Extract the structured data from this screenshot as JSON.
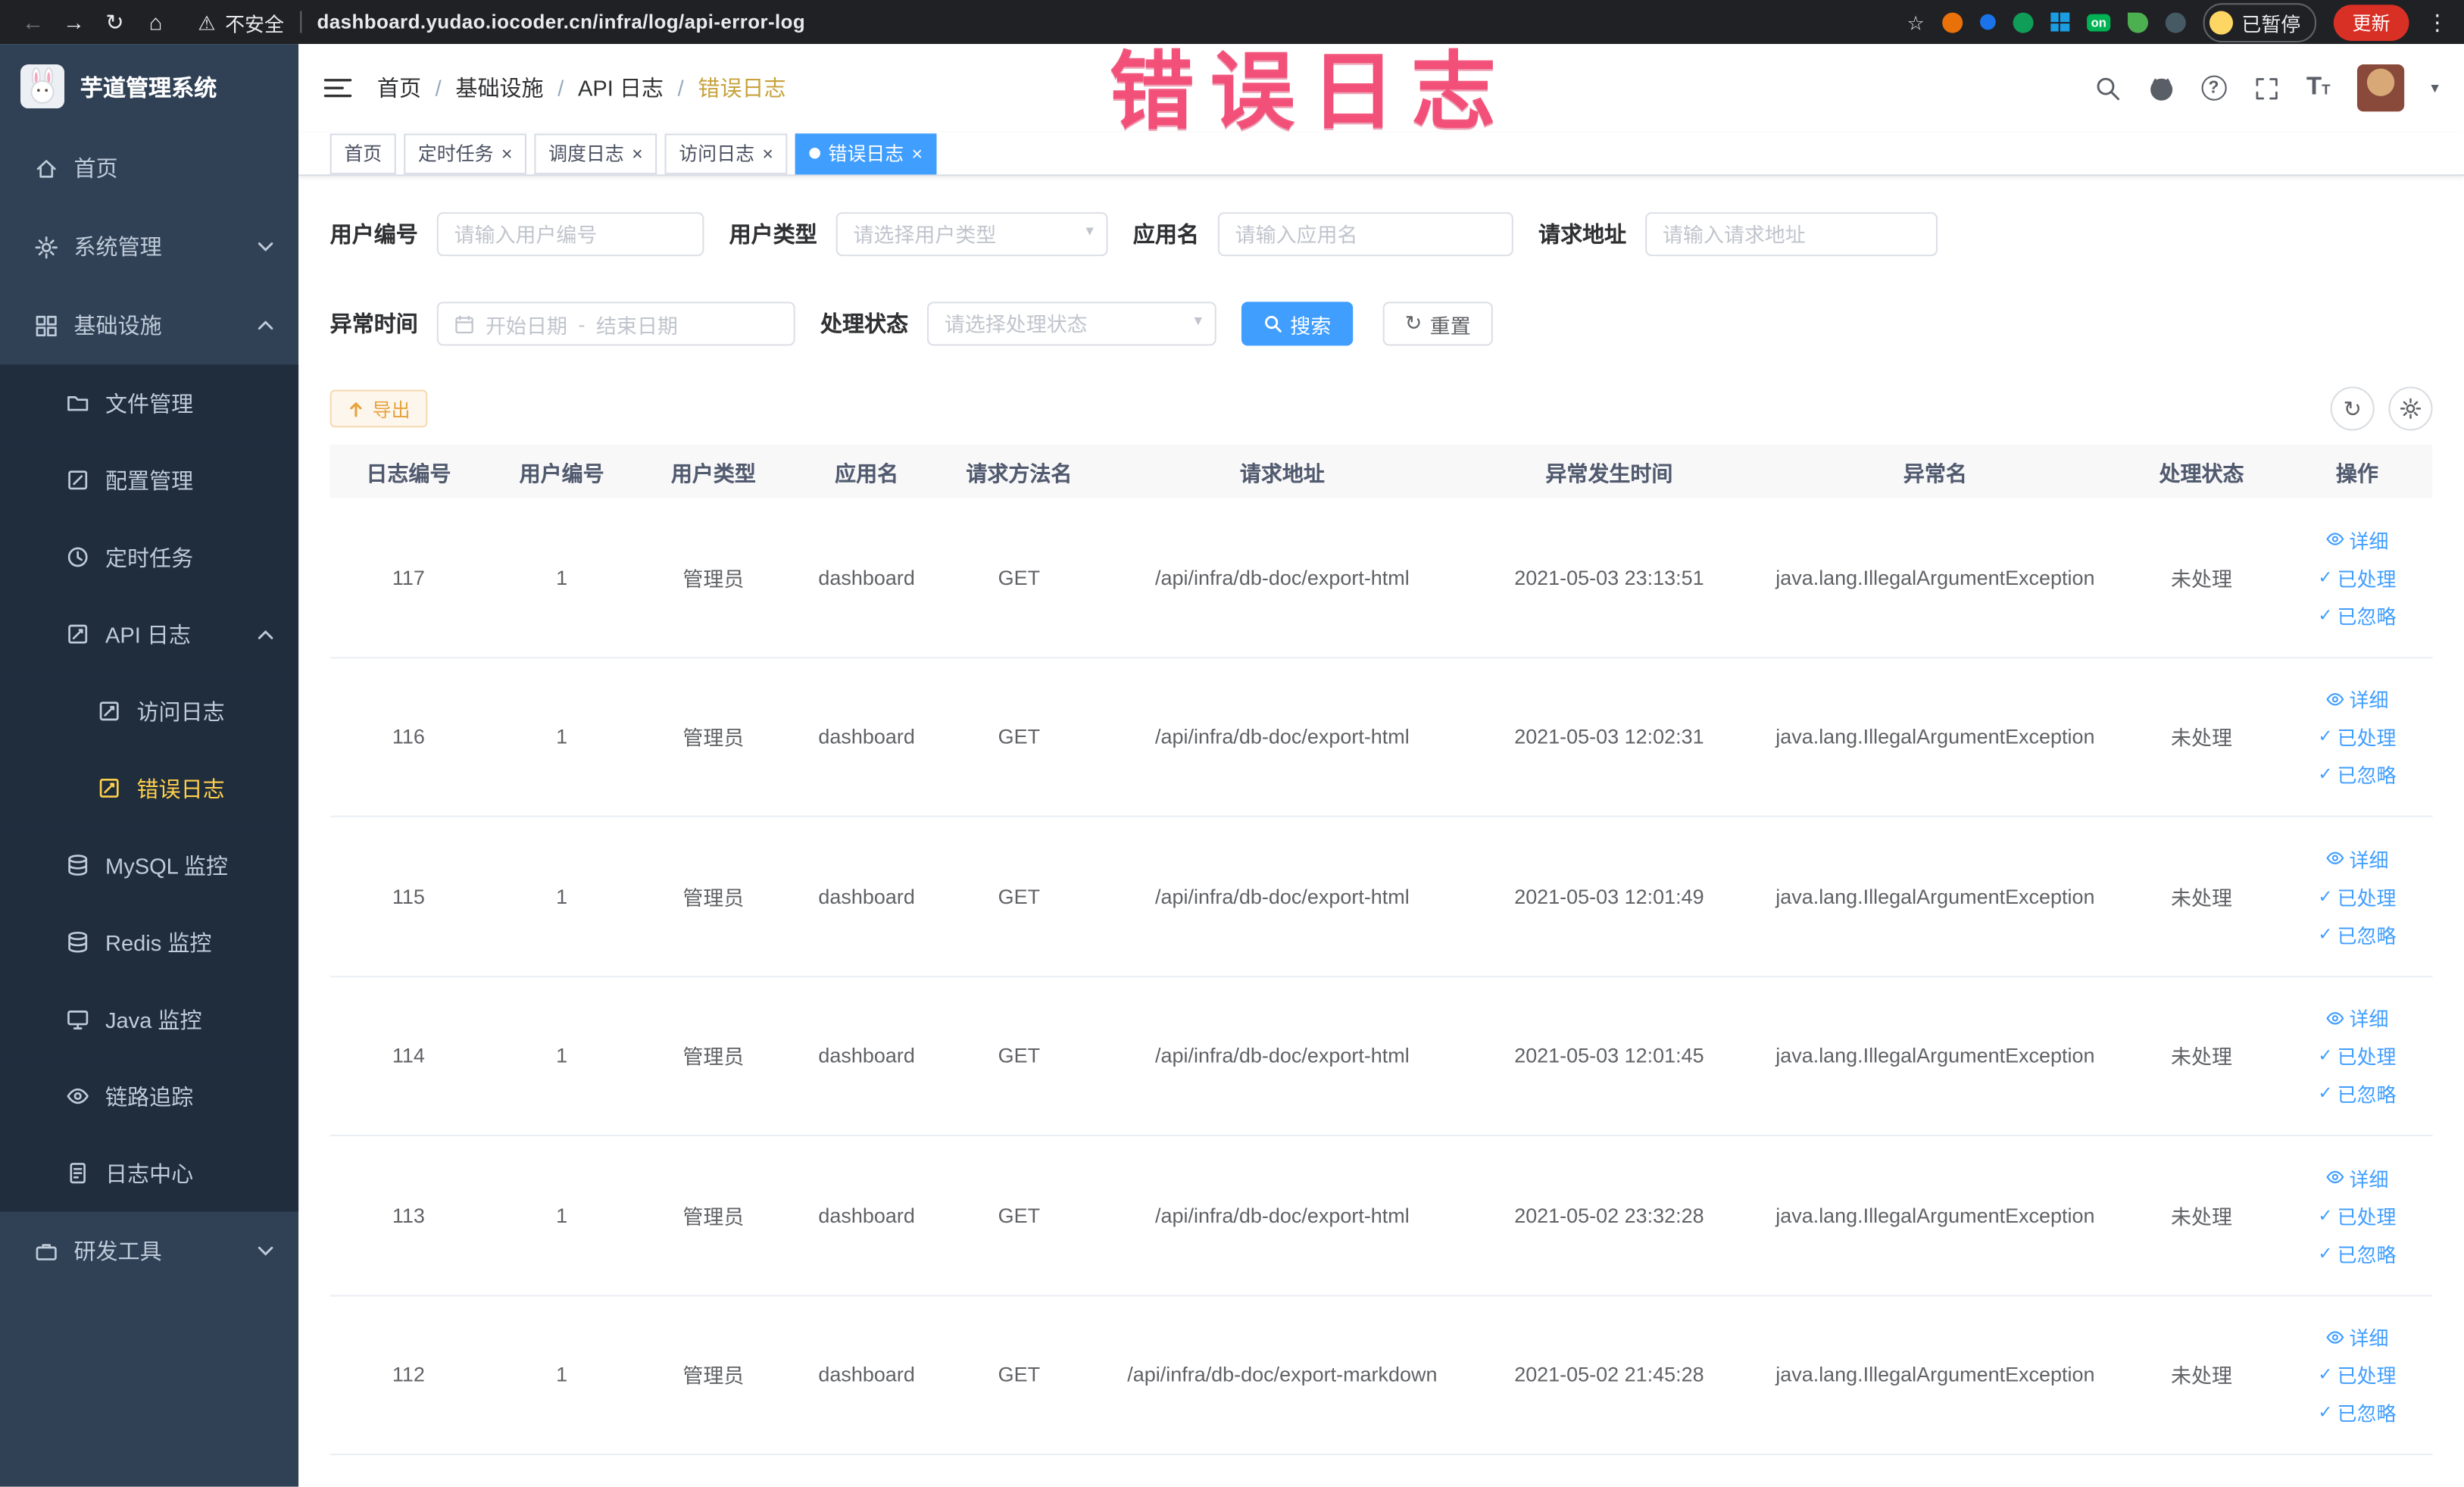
{
  "browser": {
    "security_label": "不安全",
    "url": "dashboard.yudao.iocoder.cn/infra/log/api-error-log",
    "paused_label": "已暂停",
    "update_label": "更新",
    "extension_badge_on": "on"
  },
  "icons": {
    "back": "←",
    "forward": "→",
    "reload": "↻",
    "home": "⌂",
    "warning": "⚠",
    "star": "☆",
    "more": "⋮",
    "close": "×",
    "check": "✓",
    "question": "?",
    "caret_down": "▾",
    "separator": "/",
    "refresh": "↻",
    "font_large": "T",
    "font_small": "T"
  },
  "annotation": {
    "text": "错误日志",
    "color": "#f24972"
  },
  "sidebar": {
    "title": "芋道管理系统",
    "items": [
      {
        "label": "首页",
        "level": 1,
        "icon": "home-icon"
      },
      {
        "label": "系统管理",
        "level": 1,
        "icon": "gear-icon",
        "expandable": true,
        "expanded": false
      },
      {
        "label": "基础设施",
        "level": 1,
        "icon": "infra-icon",
        "expandable": true,
        "expanded": true
      },
      {
        "label": "文件管理",
        "level": 2,
        "icon": "folder-icon"
      },
      {
        "label": "配置管理",
        "level": 2,
        "icon": "config-icon"
      },
      {
        "label": "定时任务",
        "level": 2,
        "icon": "clock-icon"
      },
      {
        "label": "API 日志",
        "level": 2,
        "icon": "api-log-icon",
        "expandable": true,
        "expanded": true
      },
      {
        "label": "访问日志",
        "level": 3,
        "icon": "access-log-icon"
      },
      {
        "label": "错误日志",
        "level": 3,
        "icon": "error-log-icon",
        "active": true
      },
      {
        "label": "MySQL 监控",
        "level": 2,
        "icon": "mysql-icon"
      },
      {
        "label": "Redis 监控",
        "level": 2,
        "icon": "redis-icon"
      },
      {
        "label": "Java 监控",
        "level": 2,
        "icon": "java-icon"
      },
      {
        "label": "链路追踪",
        "level": 2,
        "icon": "trace-icon"
      },
      {
        "label": "日志中心",
        "level": 2,
        "icon": "log-center-icon"
      },
      {
        "label": "研发工具",
        "level": 1,
        "icon": "devtools-icon",
        "expandable": true,
        "expanded": false
      }
    ]
  },
  "header": {
    "breadcrumb": [
      "首页",
      "基础设施",
      "API 日志",
      "错误日志"
    ]
  },
  "tabs": [
    {
      "label": "首页",
      "closable": false,
      "active": false
    },
    {
      "label": "定时任务",
      "closable": true,
      "active": false
    },
    {
      "label": "调度日志",
      "closable": true,
      "active": false
    },
    {
      "label": "访问日志",
      "closable": true,
      "active": false
    },
    {
      "label": "错误日志",
      "closable": true,
      "active": true
    }
  ],
  "filters": {
    "user_id": {
      "label": "用户编号",
      "placeholder": "请输入用户编号"
    },
    "user_type": {
      "label": "用户类型",
      "placeholder": "请选择用户类型"
    },
    "app_name": {
      "label": "应用名",
      "placeholder": "请输入应用名"
    },
    "request_url": {
      "label": "请求地址",
      "placeholder": "请输入请求地址"
    },
    "exception_time": {
      "label": "异常时间",
      "start_placeholder": "开始日期",
      "separator": "-",
      "end_placeholder": "结束日期"
    },
    "process_status": {
      "label": "处理状态",
      "placeholder": "请选择处理状态"
    },
    "search_label": "搜索",
    "reset_label": "重置"
  },
  "toolbar": {
    "export_label": "导出"
  },
  "table": {
    "columns": [
      "日志编号",
      "用户编号",
      "用户类型",
      "应用名",
      "请求方法名",
      "请求地址",
      "异常发生时间",
      "异常名",
      "处理状态",
      "操作"
    ],
    "action_labels": {
      "detail": "详细",
      "processed": "已处理",
      "ignored": "已忽略"
    },
    "rows": [
      {
        "id": "117",
        "user_id": "1",
        "user_type": "管理员",
        "app": "dashboard",
        "method": "GET",
        "url": "/api/infra/db-doc/export-html",
        "time": "2021-05-03 23:13:51",
        "exception": "java.lang.IllegalArgumentException",
        "status": "未处理"
      },
      {
        "id": "116",
        "user_id": "1",
        "user_type": "管理员",
        "app": "dashboard",
        "method": "GET",
        "url": "/api/infra/db-doc/export-html",
        "time": "2021-05-03 12:02:31",
        "exception": "java.lang.IllegalArgumentException",
        "status": "未处理"
      },
      {
        "id": "115",
        "user_id": "1",
        "user_type": "管理员",
        "app": "dashboard",
        "method": "GET",
        "url": "/api/infra/db-doc/export-html",
        "time": "2021-05-03 12:01:49",
        "exception": "java.lang.IllegalArgumentException",
        "status": "未处理"
      },
      {
        "id": "114",
        "user_id": "1",
        "user_type": "管理员",
        "app": "dashboard",
        "method": "GET",
        "url": "/api/infra/db-doc/export-html",
        "time": "2021-05-03 12:01:45",
        "exception": "java.lang.IllegalArgumentException",
        "status": "未处理"
      },
      {
        "id": "113",
        "user_id": "1",
        "user_type": "管理员",
        "app": "dashboard",
        "method": "GET",
        "url": "/api/infra/db-doc/export-html",
        "time": "2021-05-02 23:32:28",
        "exception": "java.lang.IllegalArgumentException",
        "status": "未处理"
      },
      {
        "id": "112",
        "user_id": "1",
        "user_type": "管理员",
        "app": "dashboard",
        "method": "GET",
        "url": "/api/infra/db-doc/export-markdown",
        "time": "2021-05-02 21:45:28",
        "exception": "java.lang.IllegalArgumentException",
        "status": "未处理"
      }
    ]
  },
  "colors": {
    "accent": "#409eff",
    "sidebar_bg": "#304156",
    "sidebar_sub_bg": "#1f2d3d",
    "sidebar_active": "#ffd04b",
    "annotation": "#f24972",
    "export_text": "#e6a23c",
    "update_button": "#d93025",
    "tab_active_bg": "#409eff"
  }
}
